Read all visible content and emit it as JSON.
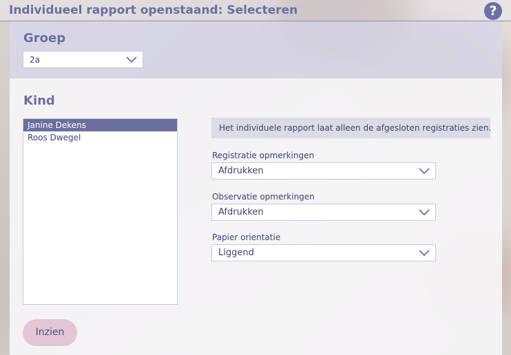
{
  "header": {
    "title": "Individueel rapport openstaand: Selecteren",
    "help_icon": "question-icon",
    "help_glyph": "?"
  },
  "groep": {
    "label": "Groep",
    "selected": "2a"
  },
  "kind": {
    "label": "Kind",
    "items": [
      {
        "name": "Janine Dekens",
        "selected": true
      },
      {
        "name": "Roos Dwegel",
        "selected": false
      }
    ]
  },
  "options": {
    "info": "Het individuele rapport laat alleen de afgesloten registraties zien.",
    "registratie": {
      "label": "Registratie opmerkingen",
      "value": "Afdrukken"
    },
    "observatie": {
      "label": "Observatie opmerkingen",
      "value": "Afdrukken"
    },
    "papier": {
      "label": "Papier orientatie",
      "value": "Liggend"
    }
  },
  "actions": {
    "inzien_label": "Inzien"
  },
  "colors": {
    "accent": "#6a6fa3",
    "selected_row": "#6a6f9e",
    "button_bg": "#e2c6d5"
  }
}
